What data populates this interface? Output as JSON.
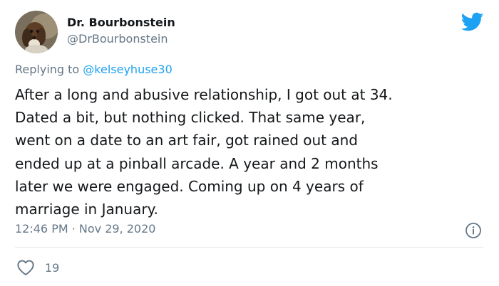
{
  "author": {
    "display_name": "Dr. Bourbonstein",
    "handle": "@DrBourbonstein"
  },
  "reply": {
    "prefix": "Replying to",
    "mention": "@kelseyhuse30"
  },
  "tweet": {
    "lines": [
      "After a long and abusive relationship, I got out at 34.",
      "Dated a bit, but nothing clicked. That same year,",
      "went on a date to an art fair, got rained out and",
      "ended up at a pinball arcade. A year and 2 months",
      "later we were engaged. Coming up on 4 years of",
      "marriage in January."
    ],
    "timestamp": "12:46 PM · Nov 29, 2020",
    "like_count": "19"
  },
  "icons": {
    "brand": "twitter-bird-icon",
    "info": "info-icon",
    "like": "heart-icon"
  },
  "colors": {
    "brand": "#1da1f2",
    "text": "#14171a",
    "secondary": "#657786",
    "divider": "#e1e8ed"
  }
}
